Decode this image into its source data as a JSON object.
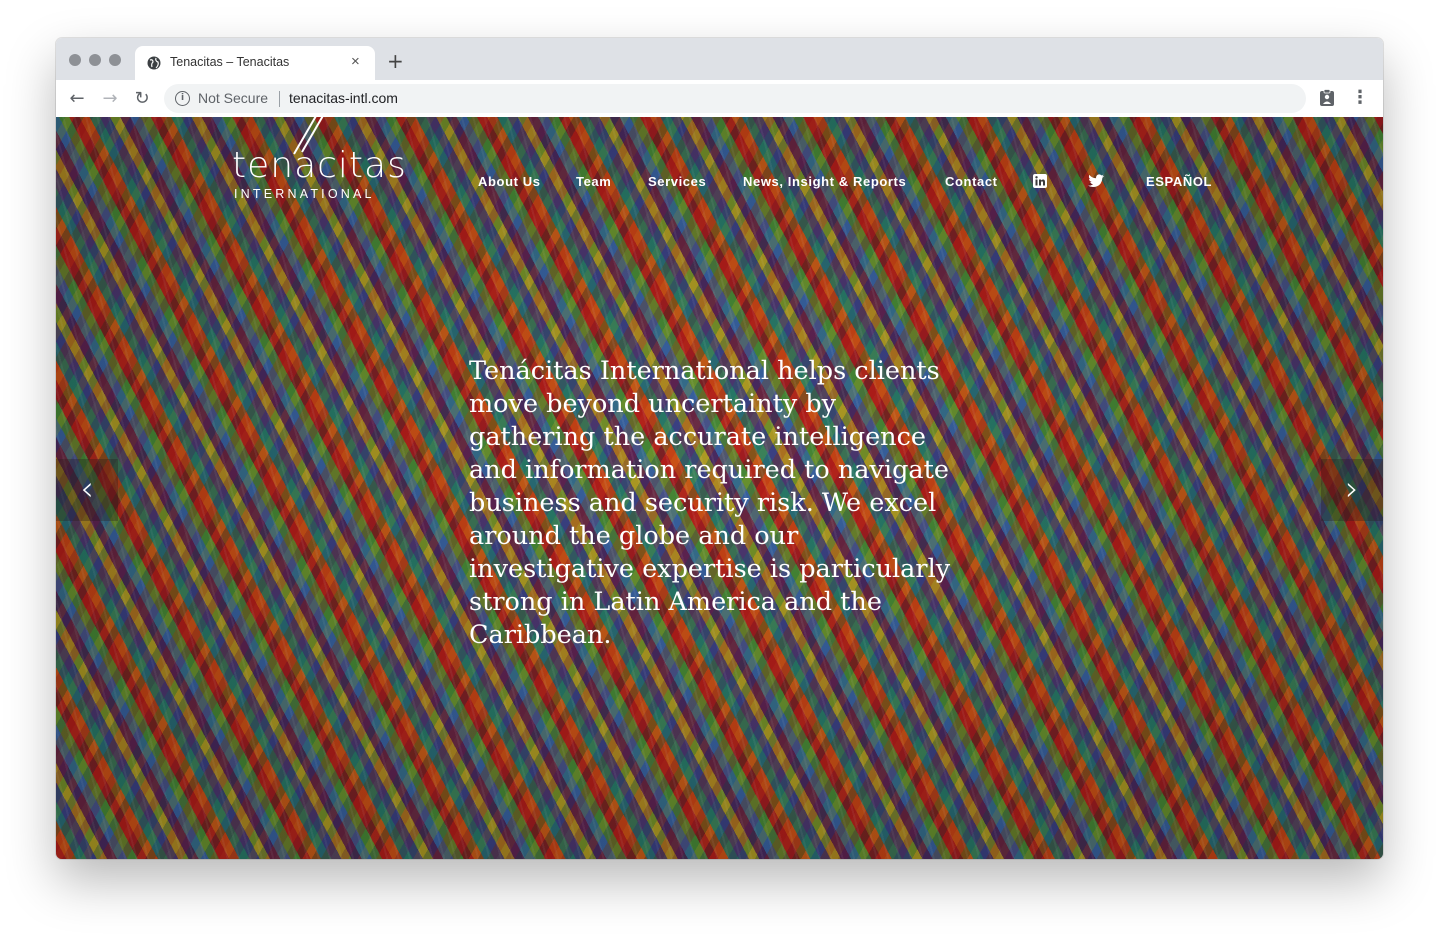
{
  "browser": {
    "tab": {
      "title": "Tenacitas – Tenacitas",
      "close": "×"
    },
    "new_tab": "+",
    "back": "←",
    "forward": "→",
    "reload": "↻",
    "security": {
      "info": "i",
      "label": "Not Secure"
    },
    "url": "tenacitas-intl.com",
    "menu": "⋮"
  },
  "site": {
    "logo": {
      "word": "tenacitas",
      "sub": "INTERNATIONAL"
    },
    "nav": {
      "about": "About Us",
      "team": "Team",
      "services": "Services",
      "news": "News, Insight & Reports",
      "contact": "Contact",
      "language": "ESPAÑOL"
    },
    "hero_text": "Tenácitas International helps clients move beyond uncertainty by gathering the accurate intelligence and information required to navigate business and security risk. We excel around the globe and our investigative expertise is particularly strong in Latin America and the Caribbean.",
    "slider": {
      "prev": "‹",
      "next": "›"
    }
  },
  "colors": {
    "chrome_bg": "#dee1e6",
    "omnibox_bg": "#f1f3f4",
    "text_on_hero": "#ffffff"
  }
}
